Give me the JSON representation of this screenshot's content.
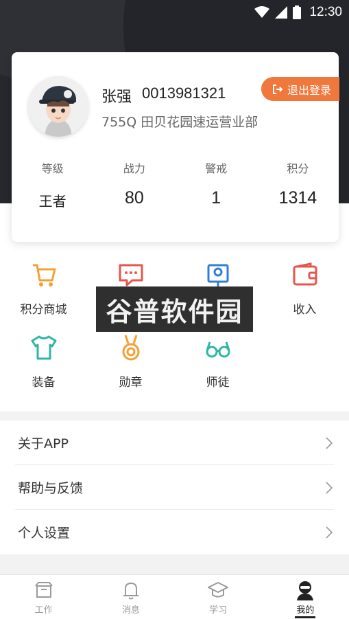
{
  "status_bar": {
    "time": "12:30",
    "icons": [
      "wifi-icon",
      "signal-icon",
      "battery-icon"
    ]
  },
  "profile": {
    "name": "张强",
    "phone": "0013981321",
    "branch": "755Q  田贝花园速运营业部",
    "logout_label": "退出登录",
    "stats": [
      {
        "label": "等级",
        "value": "王者"
      },
      {
        "label": "战力",
        "value": "80"
      },
      {
        "label": "警戒",
        "value": "1"
      },
      {
        "label": "积分",
        "value": "1314"
      }
    ]
  },
  "features": [
    {
      "label": "积分商城",
      "icon": "cart-icon"
    },
    {
      "label": "",
      "icon": "message-icon"
    },
    {
      "label": "",
      "icon": "id-card-icon"
    },
    {
      "label": "收入",
      "icon": "wallet-icon"
    },
    {
      "label": "装备",
      "icon": "tshirt-icon"
    },
    {
      "label": "勋章",
      "icon": "medal-icon"
    },
    {
      "label": "师徒",
      "icon": "glasses-icon"
    }
  ],
  "watermark": "谷普软件园",
  "menu": [
    {
      "label": "关于APP"
    },
    {
      "label": "帮助与反馈"
    },
    {
      "label": "个人设置"
    }
  ],
  "tabs": [
    {
      "label": "工作",
      "icon": "box-icon"
    },
    {
      "label": "消息",
      "icon": "bell-icon"
    },
    {
      "label": "学习",
      "icon": "graduation-cap-icon"
    },
    {
      "label": "我的",
      "icon": "user-ninja-icon",
      "active": true
    }
  ],
  "colors": {
    "accent_orange": "#f0783c",
    "teal": "#2fb6a6",
    "red": "#e5574c",
    "blue": "#2f7fd8",
    "header_dark": "#26282d"
  }
}
